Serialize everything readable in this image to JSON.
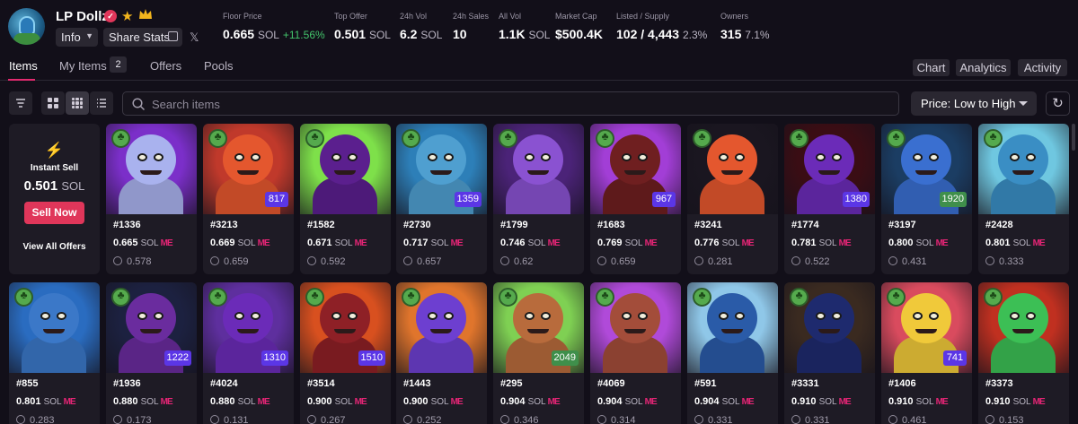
{
  "collection": {
    "name": "LP Dollz",
    "verified_mark": "✓",
    "info_label": "Info",
    "share_label": "Share Stats",
    "x_label": "𝕏"
  },
  "stats": [
    {
      "label": "Floor Price",
      "value": "0.665",
      "unit": "SOL",
      "extra": "+11.56%"
    },
    {
      "label": "Top Offer",
      "value": "0.501",
      "unit": "SOL",
      "extra": ""
    },
    {
      "label": "24h Vol",
      "value": "6.2",
      "unit": "SOL",
      "extra": ""
    },
    {
      "label": "24h Sales",
      "value": "10",
      "unit": "",
      "extra": ""
    },
    {
      "label": "All Vol",
      "value": "1.1K",
      "unit": "SOL",
      "extra": ""
    },
    {
      "label": "Market Cap",
      "value": "$500.4K",
      "unit": "",
      "extra": ""
    },
    {
      "label": "Listed / Supply",
      "value": "102 / 4,443",
      "unit": "",
      "extra": "2.3%"
    },
    {
      "label": "Owners",
      "value": "315",
      "unit": "",
      "extra": "7.1%"
    }
  ],
  "tabs": [
    {
      "label": "Items"
    },
    {
      "label": "My Items",
      "badge": "2"
    },
    {
      "label": "Offers"
    },
    {
      "label": "Pools"
    }
  ],
  "right_buttons": [
    "Chart",
    "Analytics",
    "Activity"
  ],
  "search": {
    "placeholder": "Search items"
  },
  "sort": {
    "selected": "Price: Low to High"
  },
  "instant_sell": {
    "title": "Instant Sell",
    "amount": "0.501",
    "unit": "SOL",
    "sell_label": "Sell Now",
    "view_label": "View All Offers"
  },
  "currency": "SOL",
  "marketplace_badge": "ME",
  "items": [
    {
      "id": "#1336",
      "price": "0.665",
      "offer": "0.578",
      "rank": "",
      "rank_color": "",
      "bg": "#7b2fc9",
      "skin": "#a9b2ee"
    },
    {
      "id": "#3213",
      "price": "0.669",
      "offer": "0.659",
      "rank": "817",
      "rank_color": "purple",
      "bg": "#c0392b",
      "skin": "#e4572e"
    },
    {
      "id": "#1582",
      "price": "0.671",
      "offer": "0.592",
      "rank": "",
      "rank_color": "",
      "bg": "#7ee04a",
      "skin": "#5b1f8e"
    },
    {
      "id": "#2730",
      "price": "0.717",
      "offer": "0.657",
      "rank": "1359",
      "rank_color": "purple",
      "bg": "#2d7fb8",
      "skin": "#4f9fd0"
    },
    {
      "id": "#1799",
      "price": "0.746",
      "offer": "0.62",
      "rank": "",
      "rank_color": "",
      "bg": "#4b2378",
      "skin": "#8a52d1"
    },
    {
      "id": "#1683",
      "price": "0.769",
      "offer": "0.659",
      "rank": "967",
      "rank_color": "purple",
      "bg": "#a23ed6",
      "skin": "#6f1f20"
    },
    {
      "id": "#3241",
      "price": "0.776",
      "offer": "0.281",
      "rank": "",
      "rank_color": "",
      "bg": "#1a1620",
      "skin": "#e4572e"
    },
    {
      "id": "#1774",
      "price": "0.781",
      "offer": "0.522",
      "rank": "1380",
      "rank_color": "purple",
      "bg": "#3a0d14",
      "skin": "#6b2bb8"
    },
    {
      "id": "#3197",
      "price": "0.800",
      "offer": "0.431",
      "rank": "1920",
      "rank_color": "green",
      "bg": "#1b3d63",
      "skin": "#3a6fd0"
    },
    {
      "id": "#2428",
      "price": "0.801",
      "offer": "0.333",
      "rank": "",
      "rank_color": "",
      "bg": "#6fc7e0",
      "skin": "#3a8ec4"
    },
    {
      "id": "#855",
      "price": "0.801",
      "offer": "0.283",
      "rank": "",
      "rank_color": "",
      "bg": "#2a6cc0",
      "skin": "#3b78c8"
    },
    {
      "id": "#1936",
      "price": "0.880",
      "offer": "0.173",
      "rank": "1222",
      "rank_color": "purple",
      "bg": "#1c2140",
      "skin": "#6a2c9e"
    },
    {
      "id": "#4024",
      "price": "0.880",
      "offer": "0.131",
      "rank": "1310",
      "rank_color": "purple",
      "bg": "#5e2f9e",
      "skin": "#6b2bb8"
    },
    {
      "id": "#3514",
      "price": "0.900",
      "offer": "0.267",
      "rank": "1510",
      "rank_color": "purple",
      "bg": "#d8501f",
      "skin": "#8e2026"
    },
    {
      "id": "#1443",
      "price": "0.900",
      "offer": "0.252",
      "rank": "",
      "rank_color": "",
      "bg": "#e0752c",
      "skin": "#6d3fd0"
    },
    {
      "id": "#295",
      "price": "0.904",
      "offer": "0.346",
      "rank": "2049",
      "rank_color": "green",
      "bg": "#7fd053",
      "skin": "#b86b3c"
    },
    {
      "id": "#4069",
      "price": "0.904",
      "offer": "0.314",
      "rank": "",
      "rank_color": "",
      "bg": "#b04ad9",
      "skin": "#a34d3a"
    },
    {
      "id": "#591",
      "price": "0.904",
      "offer": "0.331",
      "rank": "",
      "rank_color": "",
      "bg": "#8fc7e8",
      "skin": "#2a5ba8"
    },
    {
      "id": "#3331",
      "price": "0.910",
      "offer": "0.331",
      "rank": "",
      "rank_color": "",
      "bg": "#3a2a20",
      "skin": "#1e2a6e"
    },
    {
      "id": "#1406",
      "price": "0.910",
      "offer": "0.461",
      "rank": "741",
      "rank_color": "purple",
      "bg": "#d94b5e",
      "skin": "#f0c93a"
    },
    {
      "id": "#3373",
      "price": "0.910",
      "offer": "0.153",
      "rank": "",
      "rank_color": "",
      "bg": "#c03020",
      "skin": "#3cbf55"
    }
  ]
}
